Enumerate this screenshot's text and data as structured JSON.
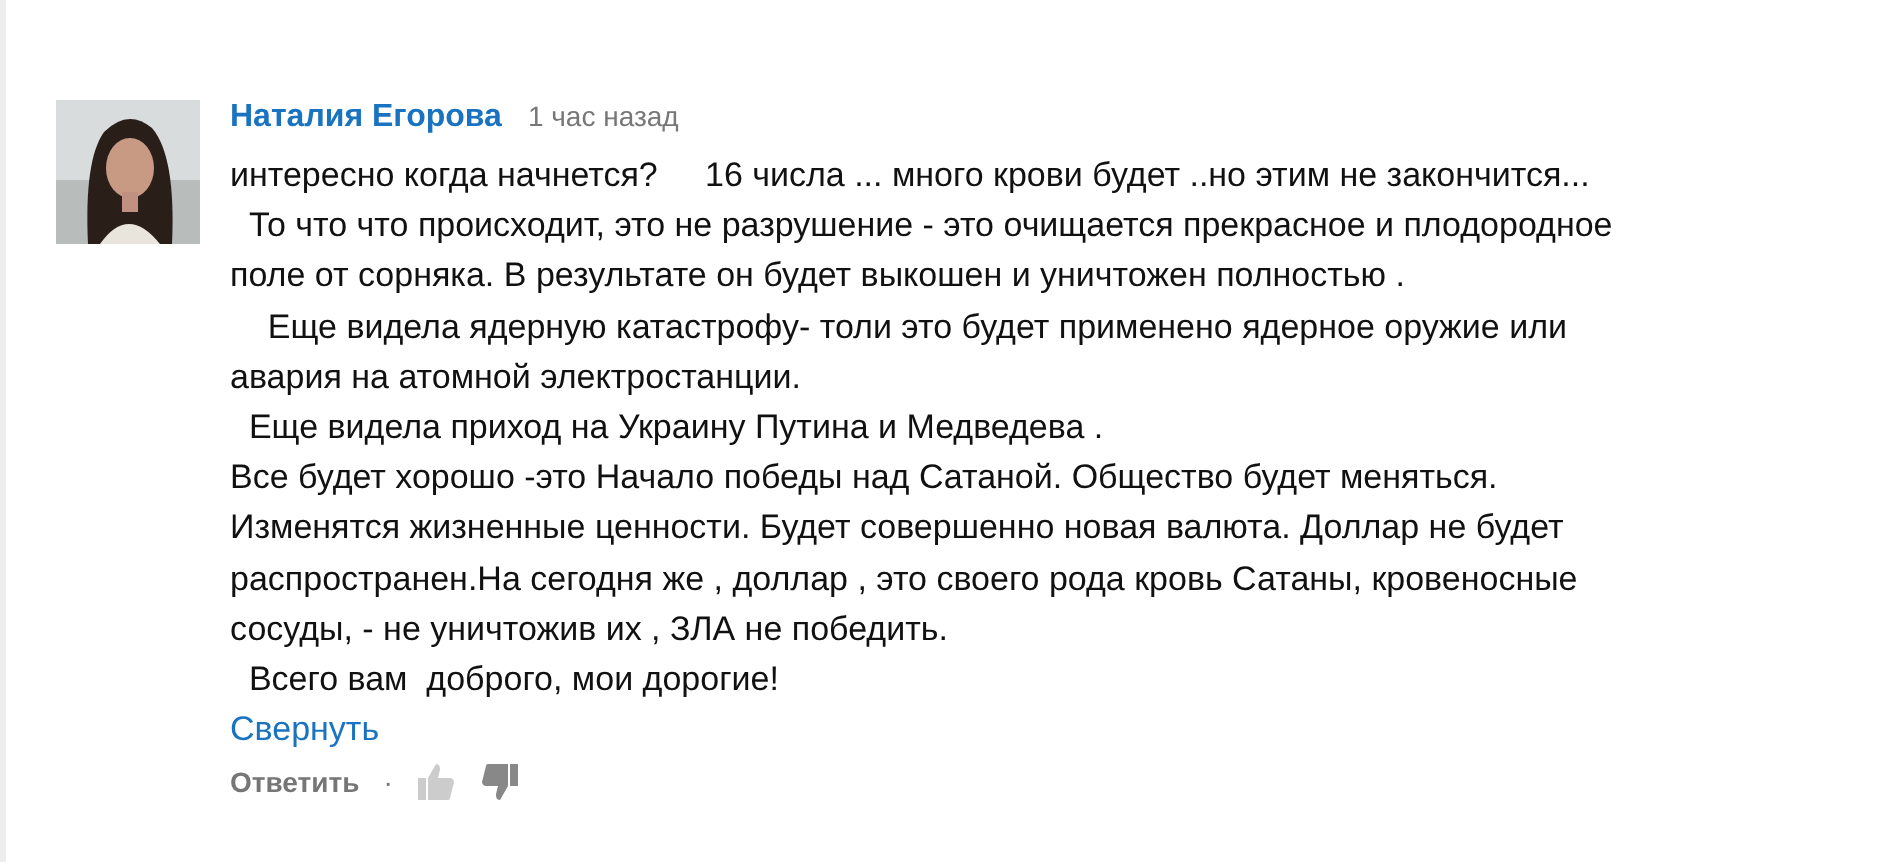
{
  "comment": {
    "author": "Наталия Егорова",
    "time": "1 час назад",
    "text": "интересно когда начнется?     16 числа ... много крови будет ..но этим не закончится...\n  То что что происходит, это не разрушение - это очищается прекрасное и плодородное\nполе от сорняка. В результате он будет выкошен и уничтожен полностью .\n    Еще видела ядерную катастрофу- толи это будет применено ядерное оружие или\nавария на атомной электростанции.\n  Еще видела приход на Украину Путина и Медведева .\nВсе будет хорошо -это Начало победы над Сатаной. Общество будет меняться.\nИзменятся жизненные ценности. Будет совершенно новая валюта. Доллар не будет\nраспространен.На сегодня же , доллар , это своего рода кровь Сатаны, кровеносные\nсосуды, - не уничтожив их , ЗЛА не победить.\n  Всего вам  доброго, мои дорогие!",
    "collapse_link": "Свернуть",
    "reply_button": "Ответить",
    "separator": "·"
  }
}
